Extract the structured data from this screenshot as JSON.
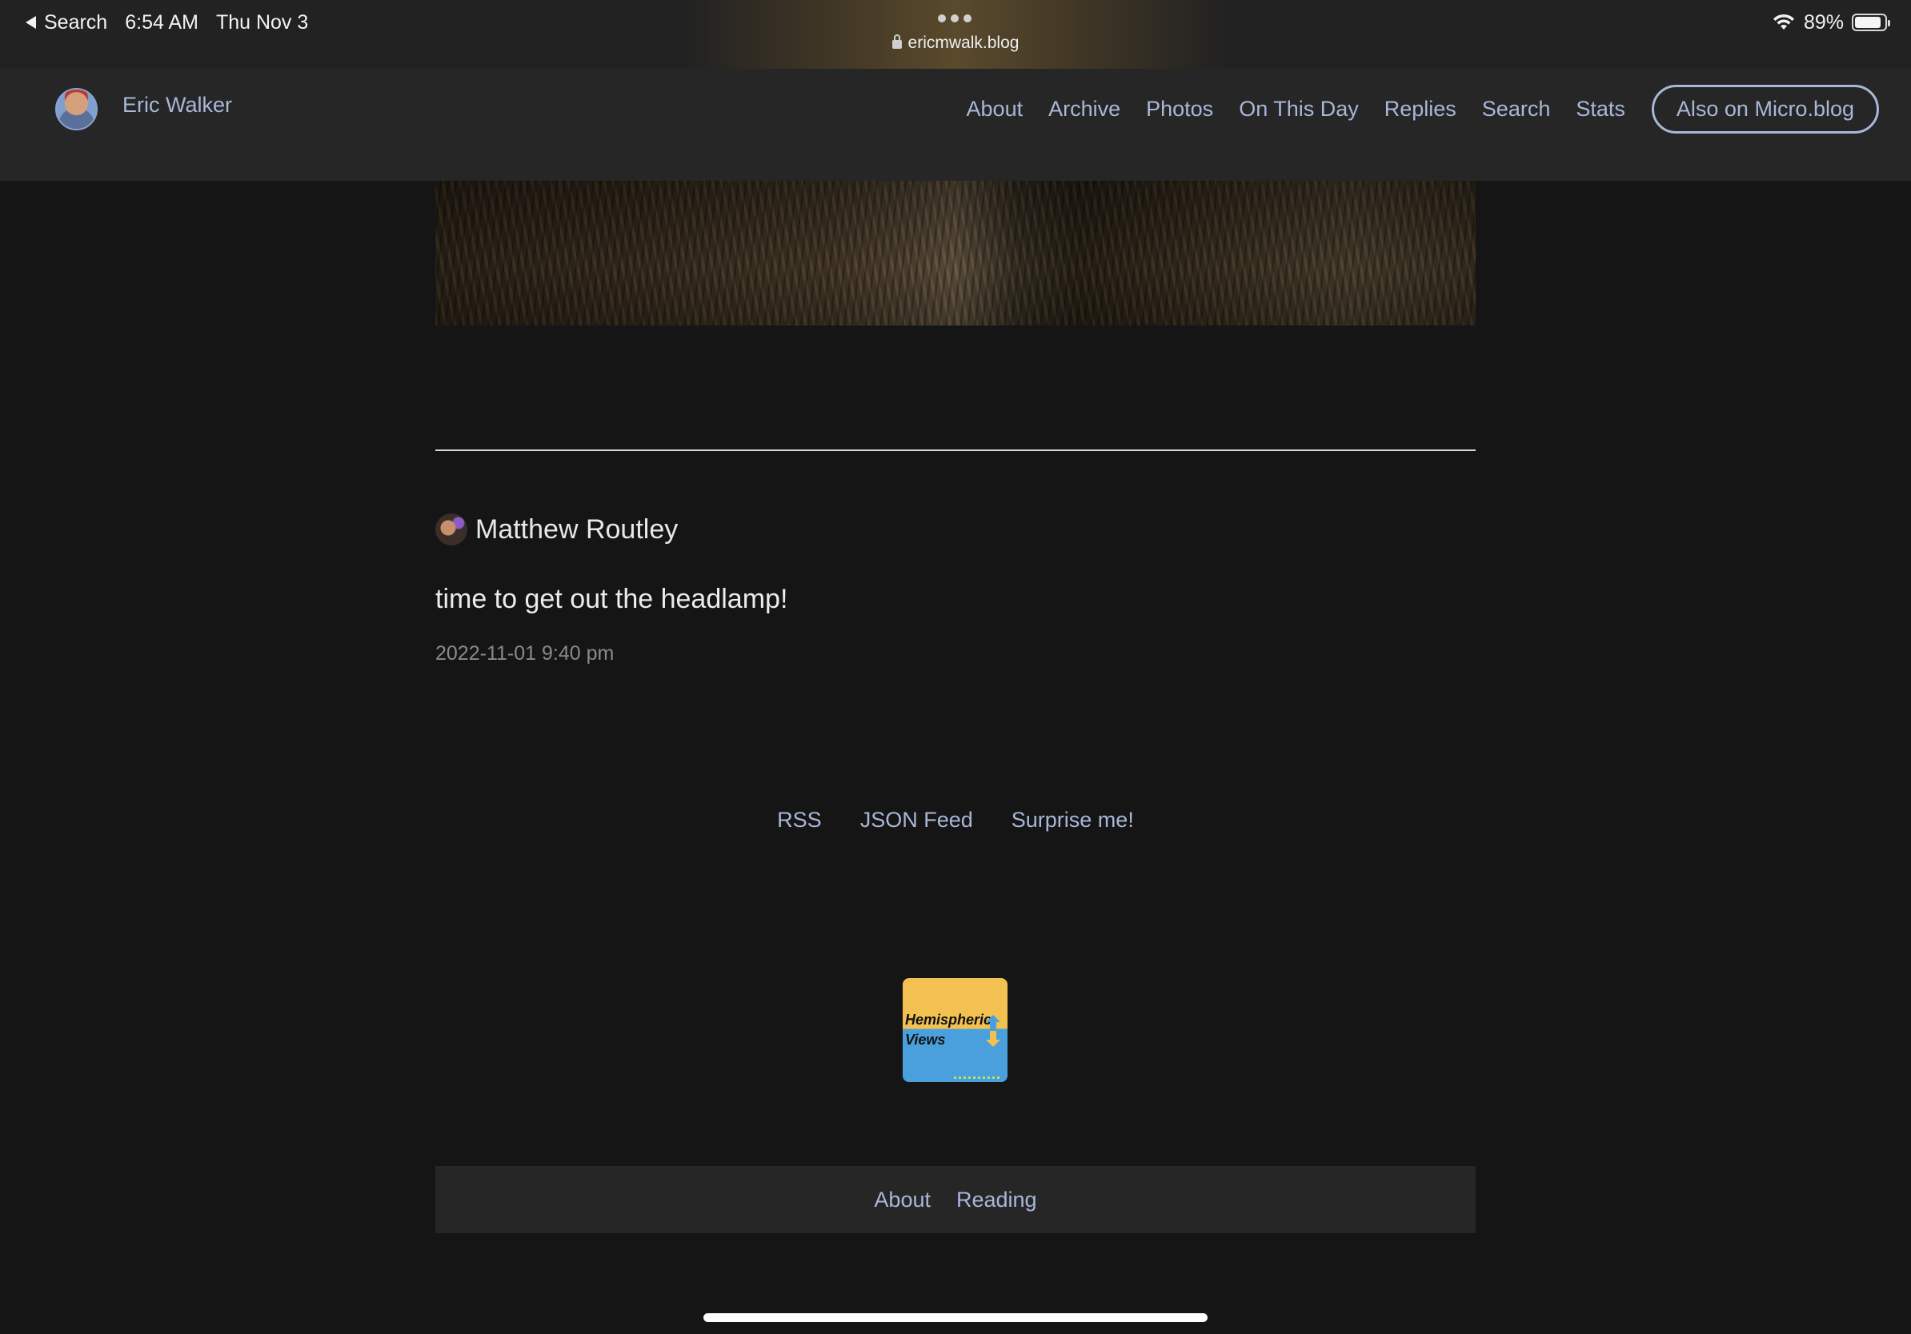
{
  "status_bar": {
    "back_label": "Search",
    "time": "6:54 AM",
    "date": "Thu Nov 3",
    "url": "ericmwalk.blog",
    "battery": "89%",
    "battery_level": 0.89
  },
  "header": {
    "site_title": "Eric Walker",
    "nav": [
      {
        "label": "About"
      },
      {
        "label": "Archive"
      },
      {
        "label": "Photos"
      },
      {
        "label": "On This Day"
      },
      {
        "label": "Replies"
      },
      {
        "label": "Search"
      },
      {
        "label": "Stats"
      }
    ],
    "microblog_button": "Also on Micro.blog"
  },
  "reply": {
    "author": "Matthew Routley",
    "text": "time to get out the headlamp!",
    "date": "2022-11-01 9:40 pm"
  },
  "footer": {
    "links": [
      {
        "label": "RSS"
      },
      {
        "label": "JSON Feed"
      },
      {
        "label": "Surprise me!"
      }
    ],
    "badge": {
      "line1": "Hemispheric",
      "line2": "Views"
    },
    "bottom_nav": [
      {
        "label": "About"
      },
      {
        "label": "Reading"
      }
    ]
  },
  "colors": {
    "background": "#151515",
    "header_bg": "#262626",
    "link": "#a9b7d8",
    "text": "#e8e8e8",
    "muted": "#8a8a8a"
  },
  "icons": [
    "back-arrow-icon",
    "lock-icon",
    "wifi-icon",
    "battery-icon",
    "more-dots-icon"
  ]
}
